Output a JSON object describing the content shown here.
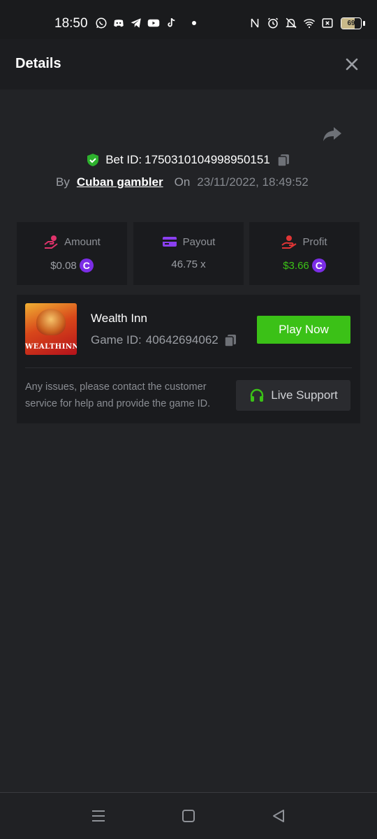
{
  "status_bar": {
    "time": "18:50",
    "left_icons": [
      "whatsapp-icon",
      "discord-icon",
      "telegram-icon",
      "youtube-icon",
      "tiktok-icon"
    ],
    "right_icons": [
      "nfc-icon",
      "alarm-icon",
      "mute-icon",
      "wifi-icon",
      "sim-x-icon"
    ],
    "battery_level": "69",
    "battery_fraction": 0.69
  },
  "header": {
    "title": "Details"
  },
  "bet": {
    "bet_id_label": "Bet ID:",
    "bet_id": "1750310104998950151",
    "by_label": "By",
    "user": "Cuban gambler",
    "on_label": "On",
    "datetime": "23/11/2022, 18:49:52"
  },
  "stats": {
    "amount": {
      "label": "Amount",
      "value": "$0.08",
      "icon": "coin-hand-icon",
      "currency_icon": "coin-c-icon"
    },
    "payout": {
      "label": "Payout",
      "value": "46.75 x",
      "icon": "card-icon"
    },
    "profit": {
      "label": "Profit",
      "value": "$3.66",
      "icon": "hand-profit-icon",
      "currency_icon": "coin-c-icon"
    }
  },
  "game": {
    "name": "Wealth Inn",
    "id_label": "Game ID:",
    "id": "40642694062",
    "thumbnail_text": "WEALTHINN",
    "play_label": "Play Now"
  },
  "support": {
    "text": "Any issues, please contact the customer service for help and provide the game ID.",
    "button_label": "Live Support"
  },
  "colors": {
    "background": "#222326",
    "card": "#1a1b1e",
    "accent_green": "#3bc117",
    "profit_green": "#3bc117",
    "shield_green": "#2db12d",
    "coin_purple": "#7b2de6",
    "amount_icon": "#e0336b",
    "payout_icon": "#8a3ff0",
    "profit_icon": "#e03535"
  }
}
